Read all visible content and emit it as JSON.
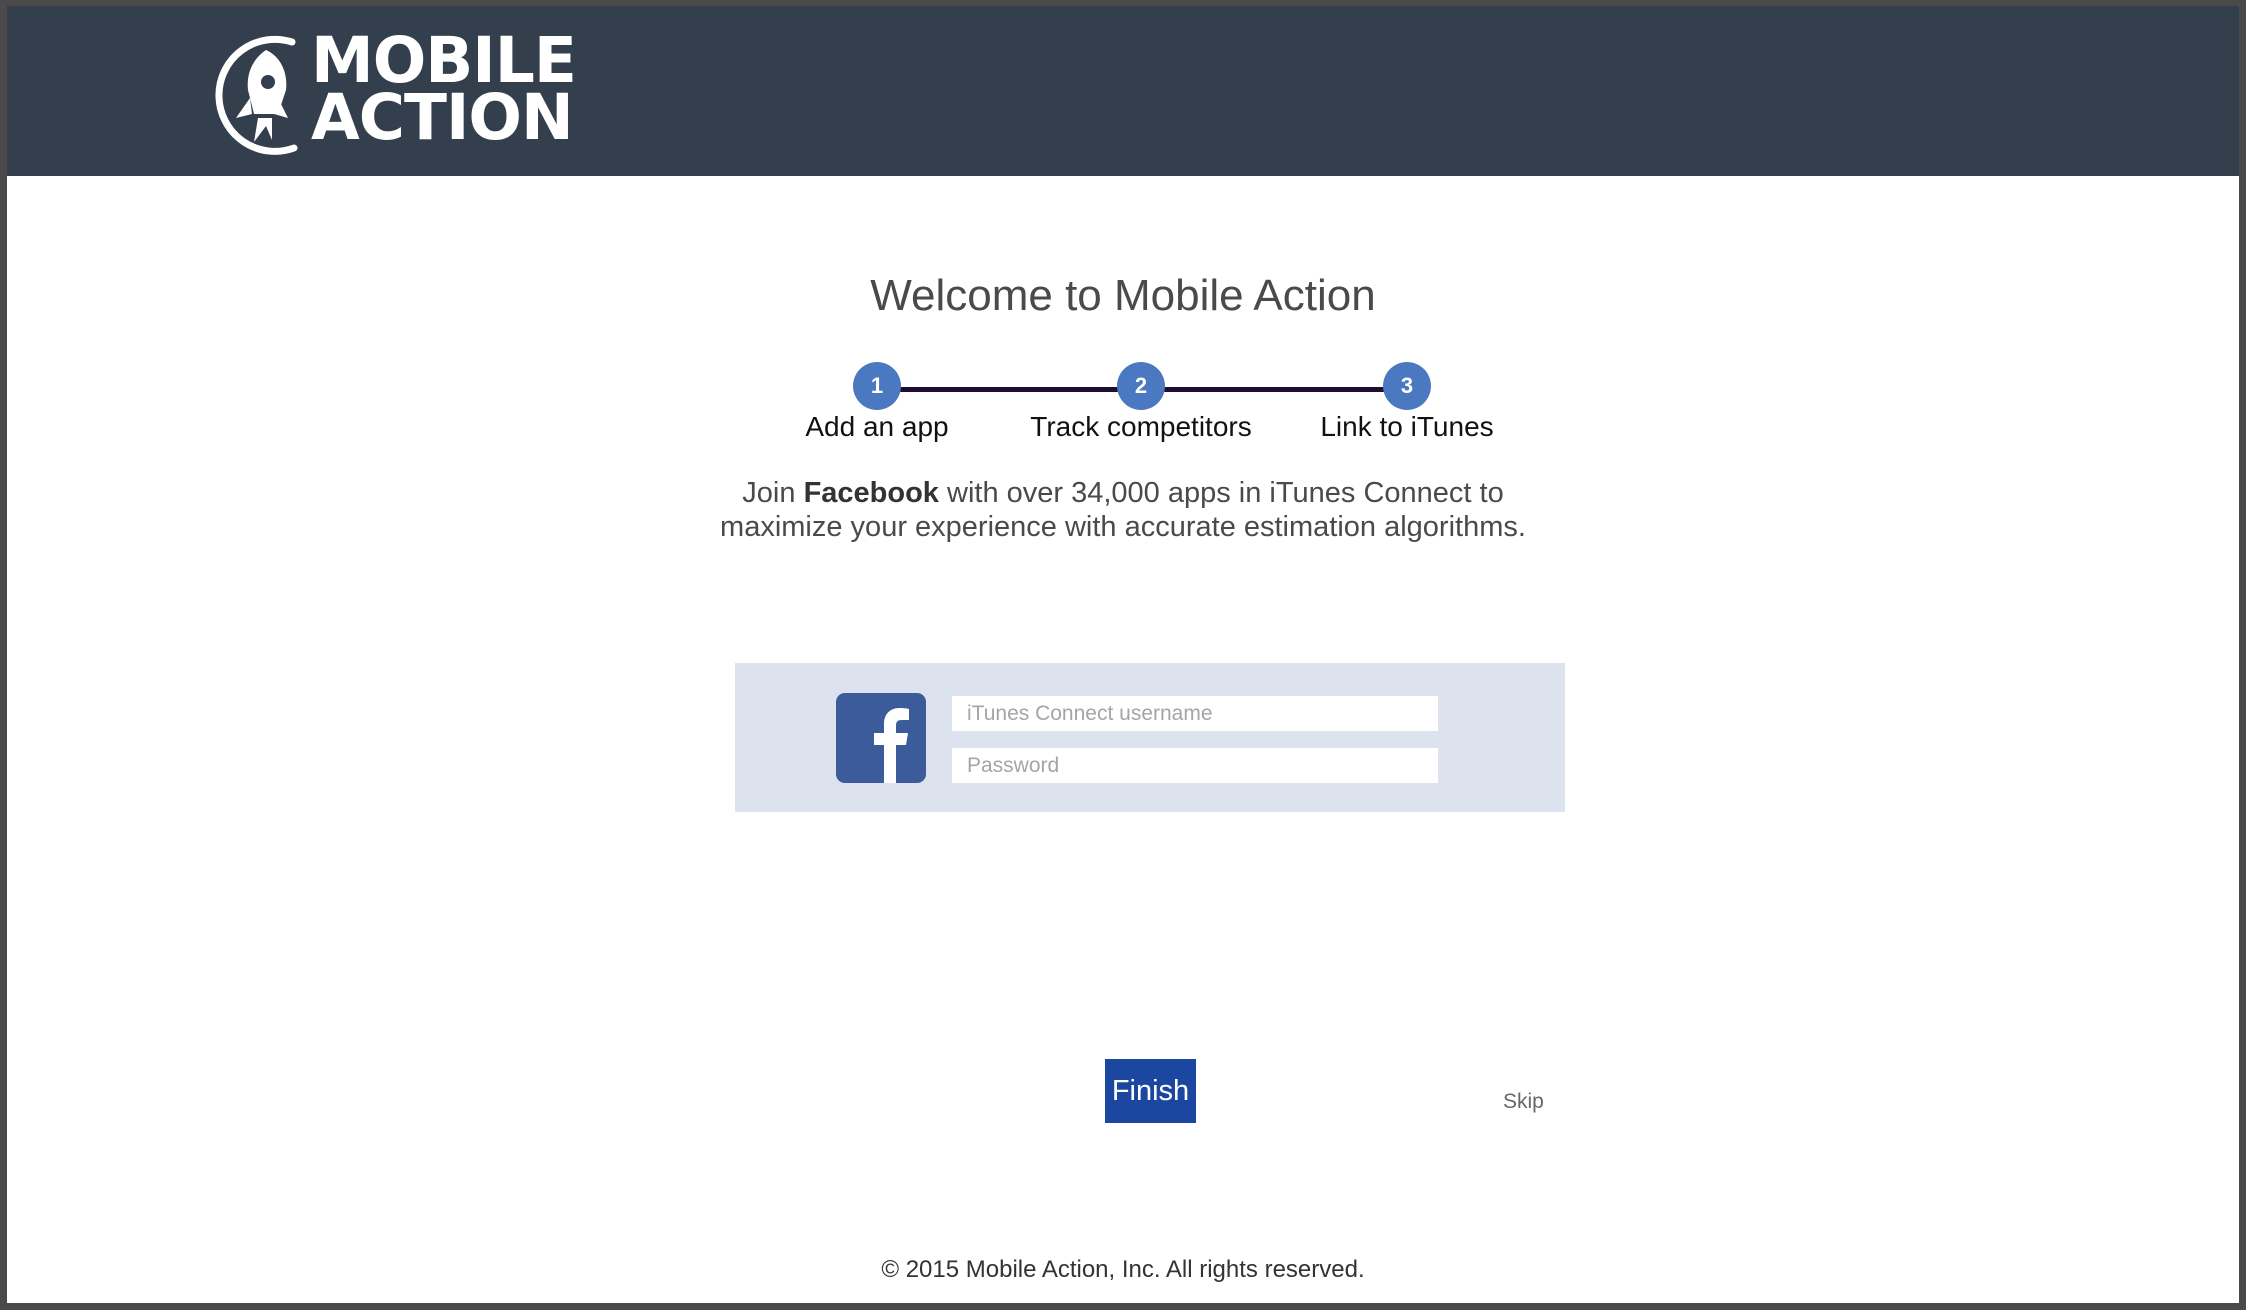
{
  "header": {
    "logo_line1": "MOBILE",
    "logo_line2": "ACTION",
    "logo_icon": "rocket-icon",
    "background_color": "#333f4c"
  },
  "main": {
    "title": "Welcome to Mobile Action",
    "steps": [
      {
        "number": "1",
        "label": "Add an app"
      },
      {
        "number": "2",
        "label": "Track competitors"
      },
      {
        "number": "3",
        "label": "Link to iTunes"
      }
    ],
    "intro": {
      "prefix": "Join ",
      "app_name": "Facebook",
      "suffix": " with over 34,000 apps in iTunes Connect to",
      "line2": "maximize your experience with accurate estimation algorithms."
    }
  },
  "login": {
    "app_icon": "facebook-icon",
    "username_placeholder": "iTunes Connect username",
    "password_placeholder": "Password"
  },
  "actions": {
    "finish_label": "Finish",
    "skip_label": "Skip"
  },
  "footer": {
    "copyright": "© 2015 Mobile Action, Inc. All rights reserved."
  },
  "colors": {
    "step_circle": "#4a79c2",
    "step_line": "#1e0d2e",
    "finish_button": "#1c47a0",
    "login_panel": "#dde3ee",
    "facebook_blue": "#3b5b9a"
  }
}
